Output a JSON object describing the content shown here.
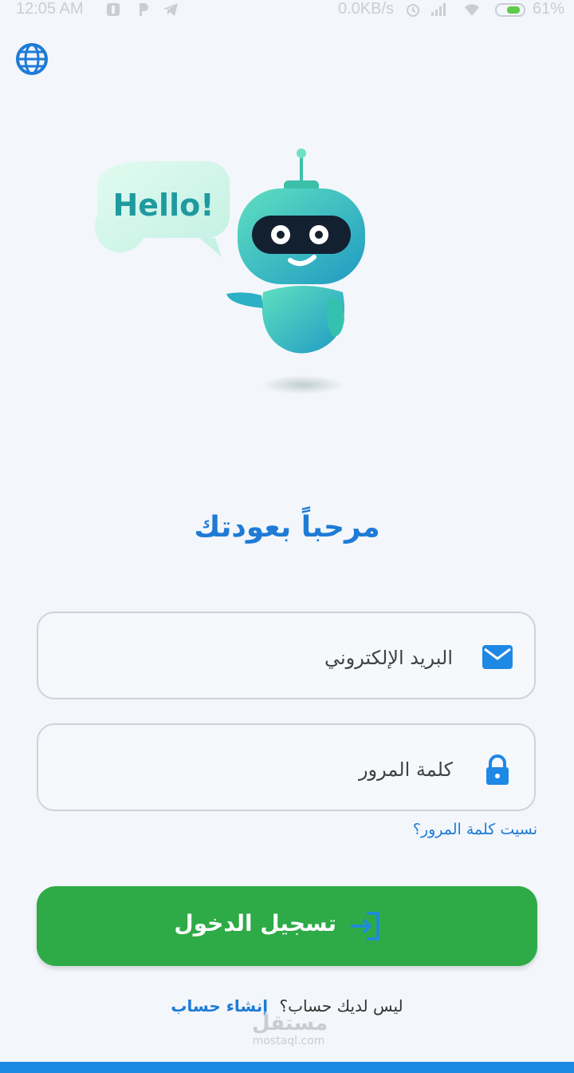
{
  "status_bar": {
    "time": "12:05 AM",
    "network_speed": "0.0KB/s",
    "battery": "61%"
  },
  "language_button": {
    "icon": "globe-icon"
  },
  "illustration": {
    "speech_bubble_text": "Hello!"
  },
  "welcome_title": "مرحباً بعودتك",
  "email": {
    "placeholder": "البريد الإلكتروني",
    "icon": "mail-icon"
  },
  "password": {
    "placeholder": "كلمة المرور",
    "icon": "lock-icon"
  },
  "forgot_password": "نسيت كلمة المرور؟",
  "login_button": {
    "label": "تسجيل الدخول",
    "icon": "login-icon"
  },
  "signup": {
    "prompt": "ليس لديك حساب؟",
    "link": "إنشاء حساب"
  },
  "watermark": {
    "arabic": "مستقل",
    "latin": "mostaql.com"
  },
  "colors": {
    "primary_blue": "#1e7bd6",
    "button_green": "#2eab47",
    "background": "#f3f6fa",
    "bottom_bar": "#1e88e5"
  }
}
